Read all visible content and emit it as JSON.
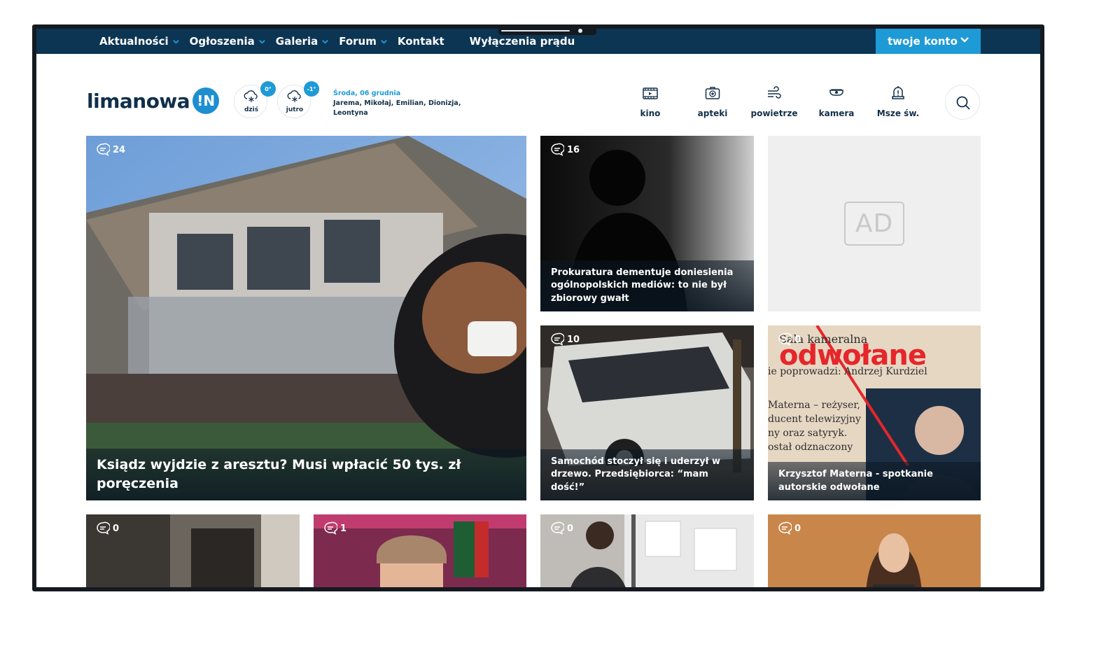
{
  "nav": {
    "items": [
      {
        "label": "Aktualności",
        "dropdown": true
      },
      {
        "label": "Ogłoszenia",
        "dropdown": true
      },
      {
        "label": "Galeria",
        "dropdown": true
      },
      {
        "label": "Forum",
        "dropdown": true
      },
      {
        "label": "Kontakt",
        "dropdown": false
      }
    ],
    "power_outages": "Wyłączenia prądu",
    "account_label": "twoje konto"
  },
  "logo": {
    "text": "limanowa",
    "badge": "!N"
  },
  "weather": [
    {
      "label": "dziś",
      "temp": "0°",
      "icon": "snow-cloud-icon"
    },
    {
      "label": "jutro",
      "temp": "-1°",
      "icon": "snow-cloud-icon"
    }
  ],
  "date": {
    "date_text": "Środa, 06 grudnia",
    "name_days": "Jarema, Mikołaj, Emilian, Dionizja, Leontyna"
  },
  "quick_links": [
    {
      "label": "kino",
      "icon": "film-icon"
    },
    {
      "label": "apteki",
      "icon": "first-aid-kit-icon"
    },
    {
      "label": "powietrze",
      "icon": "wind-icon"
    },
    {
      "label": "kamera",
      "icon": "camera-icon"
    },
    {
      "label": "Msze św.",
      "icon": "bell-icon"
    }
  ],
  "articles": {
    "main": {
      "title": "Ksiądz wyjdzie z aresztu? Musi wpłacić 50 tys. zł poręczenia",
      "comments": "24"
    },
    "a1": {
      "title": "Prokuratura dementuje doniesienia ogólnopolskich mediów: to nie był zbiorowy gwałt",
      "comments": "16"
    },
    "a2": {
      "title": "Samochód stoczył się i uderzył w drzewo. Przedsiębiorca: “mam dość!”",
      "comments": "10"
    },
    "a3": {
      "title": "Krzysztof Materna - spotkanie autorskie odwołane",
      "comments": "0",
      "image_text": {
        "line1": "Sala kameralna",
        "big": "odwołane",
        "line2": "ie poprowadzi: Andrzej Kurdziel",
        "body": [
          "Materna – reżyser,",
          "ducent telewizyjny",
          "ny oraz satyryk.",
          "ostał odznaczony"
        ]
      }
    },
    "b1": {
      "comments": "0"
    },
    "b2": {
      "comments": "1"
    },
    "b3": {
      "comments": "0"
    },
    "b4": {
      "comments": "0"
    }
  },
  "ad": {
    "label": "AD"
  },
  "colors": {
    "nav_bg": "#0c3553",
    "accent": "#1e9ad6"
  }
}
